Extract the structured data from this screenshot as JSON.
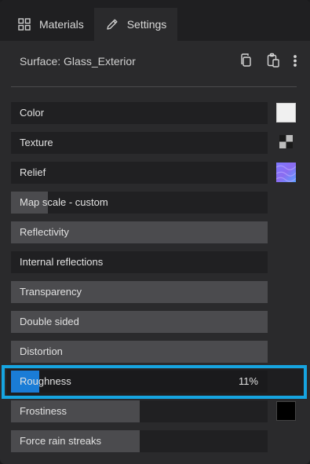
{
  "tabs": [
    {
      "label": "Materials",
      "icon": "grid-icon"
    },
    {
      "label": "Settings",
      "icon": "pencil-icon"
    }
  ],
  "surface": {
    "label": "Surface: Glass_Exterior"
  },
  "header_icons": [
    "copy-icon",
    "paste-icon",
    "more-vertical-icon"
  ],
  "properties": [
    {
      "label": "Color",
      "fill": 0,
      "swatch": "white"
    },
    {
      "label": "Texture",
      "fill": 0,
      "swatch": "checker"
    },
    {
      "label": "Relief",
      "fill": 0,
      "swatch": "normal-map"
    },
    {
      "label": "Map scale - custom",
      "fill": 0.145
    },
    {
      "label": "Reflectivity",
      "fill": 1.0
    },
    {
      "label": "Internal reflections",
      "fill": 0
    },
    {
      "label": "Transparency",
      "fill": 1.0
    },
    {
      "label": "Double sided",
      "fill": 1.0
    },
    {
      "label": "Distortion",
      "fill": 1.0
    },
    {
      "label": "Roughness",
      "fill": 0.11,
      "value": "11%",
      "highlighted": true
    },
    {
      "label": "Frostiness",
      "fill": 0.5,
      "swatch": "black"
    },
    {
      "label": "Force rain streaks",
      "fill": 0.5
    }
  ],
  "colors": {
    "accent": "#16a4e0",
    "fill": "#4b4b4e",
    "active_fill": "#1a7cd6"
  }
}
